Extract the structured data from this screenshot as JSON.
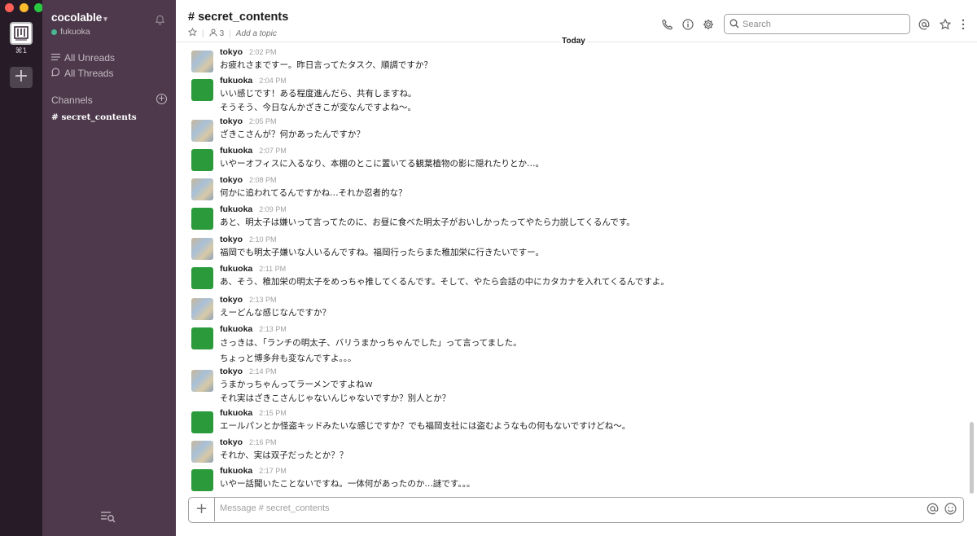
{
  "workspace": {
    "name": "cocolable",
    "user": "fukuoka",
    "shortcut": "⌘1"
  },
  "sidebar": {
    "all_unreads": "All Unreads",
    "all_threads": "All Threads",
    "channels_heading": "Channels",
    "channels": [
      "# secret_contents"
    ]
  },
  "header": {
    "title": "# secret_contents",
    "member_count": "3",
    "topic": "Add a topic",
    "search_placeholder": "Search",
    "day_divider": "Today"
  },
  "messages": [
    {
      "author": "tokyo",
      "time": "2:02 PM",
      "avatar": "tokyo",
      "lines": [
        "お疲れさまですー。昨日言ってたタスク、順調ですか？"
      ]
    },
    {
      "author": "fukuoka",
      "time": "2:04 PM",
      "avatar": "fukuoka",
      "lines": [
        "いい感じです！ある程度進んだら、共有しますね。",
        "そうそう、今日なんかざきこが変なんですよね〜。"
      ]
    },
    {
      "author": "tokyo",
      "time": "2:05 PM",
      "avatar": "tokyo",
      "lines": [
        "ざきこさんが？何かあったんですか？"
      ]
    },
    {
      "author": "fukuoka",
      "time": "2:07 PM",
      "avatar": "fukuoka",
      "lines": [
        "いやーオフィスに入るなり、本棚のとこに置いてる観葉植物の影に隠れたりとか…。"
      ]
    },
    {
      "author": "tokyo",
      "time": "2:08 PM",
      "avatar": "tokyo",
      "lines": [
        "何かに追われてるんですかね…それか忍者的な？"
      ]
    },
    {
      "author": "fukuoka",
      "time": "2:09 PM",
      "avatar": "fukuoka",
      "lines": [
        "あと、明太子は嫌いって言ってたのに、お昼に食べた明太子がおいしかったってやたら力説してくるんです。"
      ]
    },
    {
      "author": "tokyo",
      "time": "2:10 PM",
      "avatar": "tokyo",
      "lines": [
        "福岡でも明太子嫌いな人いるんですね。福岡行ったらまた稚加栄に行きたいですー。"
      ]
    },
    {
      "author": "fukuoka",
      "time": "2:11 PM",
      "avatar": "fukuoka",
      "lines": [
        "あ、そう、稚加栄の明太子をめっちゃ推してくるんです。そして、やたら会話の中にカタカナを入れてくるんですよ。"
      ]
    },
    {
      "author": "tokyo",
      "time": "2:13 PM",
      "avatar": "tokyo",
      "lines": [
        "えーどんな感じなんですか？"
      ]
    },
    {
      "author": "fukuoka",
      "time": "2:13 PM",
      "avatar": "fukuoka",
      "lines": [
        "さっきは、「ランチの明太子、バリうまかっちゃんでした」って言ってました。",
        "ちょっと博多弁も変なんですよ。。。"
      ]
    },
    {
      "author": "tokyo",
      "time": "2:14 PM",
      "avatar": "tokyo",
      "lines": [
        "うまかっちゃんってラーメンですよねｗ",
        "それ実はざきこさんじゃないんじゃないですか？別人とか？"
      ]
    },
    {
      "author": "fukuoka",
      "time": "2:15 PM",
      "avatar": "fukuoka",
      "lines": [
        "エールパンとか怪盗キッドみたいな感じですか？でも福岡支社には盗むようなもの何もないですけどね〜。"
      ]
    },
    {
      "author": "tokyo",
      "time": "2:16 PM",
      "avatar": "tokyo",
      "lines": [
        "それか、実は双子だったとか？？"
      ]
    },
    {
      "author": "fukuoka",
      "time": "2:17 PM",
      "avatar": "fukuoka",
      "lines": [
        "いやー話聞いたことないですね。一体何があったのか…謎です。。。"
      ]
    }
  ],
  "composer": {
    "placeholder": "Message # secret_contents"
  },
  "icons": {
    "bell": "bell-icon",
    "phone": "phone-icon",
    "info": "info-icon",
    "settings": "gear-icon",
    "search": "search-icon",
    "mentions": "at-sign-icon",
    "star": "star-icon",
    "more": "more-vertical-icon",
    "emoji": "emoji-icon"
  }
}
